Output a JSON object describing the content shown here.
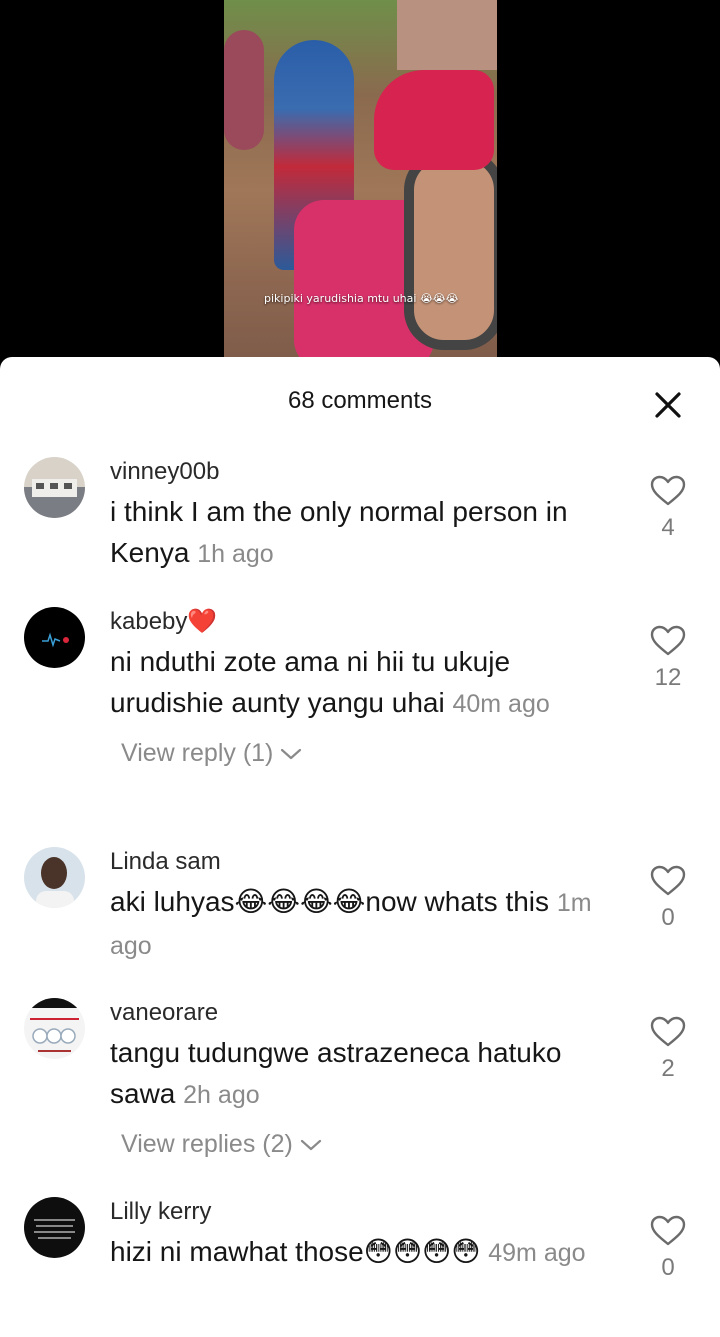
{
  "video": {
    "caption": "pikipiki yarudishia mtu uhai 😭😭😭"
  },
  "header": {
    "title": "68 comments"
  },
  "comments": [
    {
      "username": "vinney00b",
      "text": "i think I am the only normal person in Kenya",
      "time": "1h ago",
      "likes": "4",
      "reply_label": ""
    },
    {
      "username": "kabeby❤️",
      "text": "ni nduthi zote ama ni hii tu ukuje urudishie aunty yangu uhai",
      "time": "40m ago",
      "likes": "12",
      "reply_label": "View reply (1)"
    },
    {
      "username": "Linda sam",
      "text": "aki luhyas😂😂😂😂now whats this",
      "time": "1m ago",
      "likes": "0",
      "reply_label": ""
    },
    {
      "username": "vaneorare",
      "text": "tangu tudungwe astrazeneca hatuko sawa",
      "time": "2h ago",
      "likes": "2",
      "reply_label": "View replies (2)"
    },
    {
      "username": "Lilly kerry",
      "text": "hizi ni mawhat those😳😳😳😳",
      "time": "49m ago",
      "likes": "0",
      "reply_label": ""
    }
  ],
  "colors": {
    "sheet_bg": "#ffffff",
    "text_primary": "#161616",
    "text_muted": "#8a8a8a"
  },
  "icons": {
    "close": "close-icon",
    "like": "heart-outline-icon",
    "expand": "chevron-down-icon"
  }
}
